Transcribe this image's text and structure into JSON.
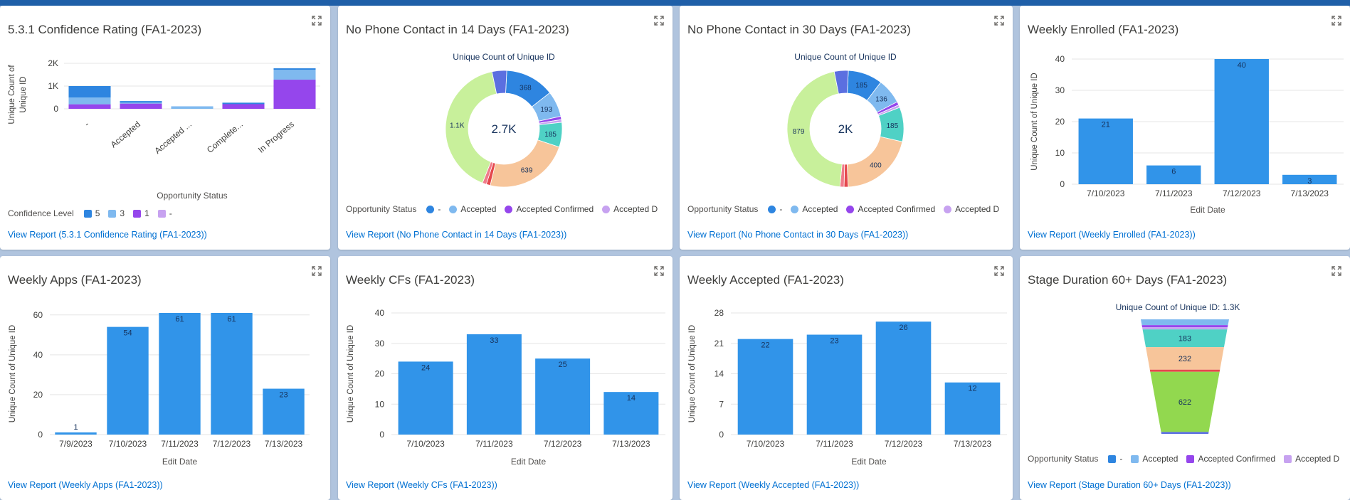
{
  "colors": {
    "status_dash": "#2e85e0",
    "accepted": "#7fb9ef",
    "accepted_confirmed": "#9546ec",
    "accepted_d": "#c7a2f0",
    "teal": "#4fd1c5",
    "peach": "#f7c59a",
    "red": "#e5484d",
    "green_light": "#c8f09b",
    "green": "#92d84f",
    "conf5": "#2e85e0",
    "conf3": "#7fb9ef",
    "conf1": "#9546ec",
    "conf_dash": "#c7a2f0",
    "bar": "#3194e9",
    "link": "#0070d2"
  },
  "cards": {
    "confidence": {
      "title": "5.3.1 Confidence Rating (FA1-2023)",
      "link": "View Report (5.3.1 Confidence Rating (FA1-2023))",
      "legend_title": "Confidence Level",
      "legend": [
        "5",
        "3",
        "1",
        "-"
      ]
    },
    "phone14": {
      "title": "No Phone Contact in 14 Days (FA1-2023)",
      "link": "View Report (No Phone Contact in 14 Days (FA1-2023))",
      "legend_title": "Opportunity Status",
      "legend": [
        "-",
        "Accepted",
        "Accepted Confirmed",
        "Accepted D"
      ]
    },
    "phone30": {
      "title": "No Phone Contact in 30 Days (FA1-2023)",
      "link": "View Report (No Phone Contact in 30 Days (FA1-2023))",
      "legend_title": "Opportunity Status",
      "legend": [
        "-",
        "Accepted",
        "Accepted Confirmed",
        "Accepted D"
      ]
    },
    "enrolled": {
      "title": "Weekly Enrolled (FA1-2023)",
      "link": "View Report (Weekly Enrolled (FA1-2023))"
    },
    "apps": {
      "title": "Weekly Apps (FA1-2023)",
      "link": "View Report (Weekly Apps (FA1-2023))"
    },
    "cfs": {
      "title": "Weekly CFs (FA1-2023)",
      "link": "View Report (Weekly CFs (FA1-2023))"
    },
    "accepted": {
      "title": "Weekly Accepted (FA1-2023)",
      "link": "View Report (Weekly Accepted (FA1-2023))"
    },
    "stage": {
      "title": "Stage Duration 60+ Days (FA1-2023)",
      "link": "View Report (Stage Duration 60+ Days (FA1-2023))",
      "legend_title": "Opportunity Status",
      "legend": [
        "-",
        "Accepted",
        "Accepted Confirmed",
        "Accepted D"
      ]
    }
  },
  "chart_data": [
    {
      "id": "confidence",
      "type": "bar",
      "stacked": true,
      "title": "",
      "xlabel": "Opportunity Status",
      "ylabel": "Unique Count of Unique ID",
      "categories": [
        "-",
        "Accepted",
        "Accepted ...",
        "Complete...",
        "In Progress"
      ],
      "yticks": [
        "0",
        "1K",
        "2K"
      ],
      "ylim": [
        0,
        2000
      ],
      "series": [
        {
          "name": "1",
          "values": [
            200,
            230,
            0,
            220,
            1280
          ]
        },
        {
          "name": "3",
          "values": [
            300,
            70,
            110,
            0,
            440
          ]
        },
        {
          "name": "5",
          "values": [
            500,
            40,
            0,
            50,
            60
          ]
        }
      ]
    },
    {
      "id": "phone14",
      "type": "pie",
      "title": "Unique Count of Unique ID",
      "center_label": "2.7K",
      "slices": [
        {
          "label": "368",
          "value": 368
        },
        {
          "label": "193",
          "value": 193
        },
        {
          "label": "",
          "value": 25
        },
        {
          "label": "",
          "value": 20
        },
        {
          "label": "185",
          "value": 185
        },
        {
          "label": "639",
          "value": 639
        },
        {
          "label": "",
          "value": 30
        },
        {
          "label": "",
          "value": 30
        },
        {
          "label": "1.1K",
          "value": 1100
        },
        {
          "label": "",
          "value": 110
        }
      ]
    },
    {
      "id": "phone30",
      "type": "pie",
      "title": "Unique Count of Unique ID",
      "center_label": "2K",
      "slices": [
        {
          "label": "185",
          "value": 185
        },
        {
          "label": "136",
          "value": 136
        },
        {
          "label": "",
          "value": 18
        },
        {
          "label": "",
          "value": 14
        },
        {
          "label": "185",
          "value": 185
        },
        {
          "label": "400",
          "value": 400
        },
        {
          "label": "",
          "value": 22
        },
        {
          "label": "",
          "value": 22
        },
        {
          "label": "879",
          "value": 879
        },
        {
          "label": "",
          "value": 75
        }
      ]
    },
    {
      "id": "enrolled",
      "type": "bar",
      "xlabel": "Edit Date",
      "ylabel": "Unique Count of Unique ID",
      "categories": [
        "7/10/2023",
        "7/11/2023",
        "7/12/2023",
        "7/13/2023"
      ],
      "values": [
        21,
        6,
        40,
        3
      ],
      "yticks": [
        0,
        10,
        20,
        30,
        40
      ],
      "ylim": [
        0,
        40
      ]
    },
    {
      "id": "apps",
      "type": "bar",
      "xlabel": "Edit Date",
      "ylabel": "Unique Count of Unique ID",
      "categories": [
        "7/9/2023",
        "7/10/2023",
        "7/11/2023",
        "7/12/2023",
        "7/13/2023"
      ],
      "values": [
        1,
        54,
        61,
        61,
        23
      ],
      "yticks": [
        0,
        20,
        40,
        60
      ],
      "ylim": [
        0,
        61
      ]
    },
    {
      "id": "cfs",
      "type": "bar",
      "xlabel": "Edit Date",
      "ylabel": "Unique Count of Unique ID",
      "categories": [
        "7/10/2023",
        "7/11/2023",
        "7/12/2023",
        "7/13/2023"
      ],
      "values": [
        24,
        33,
        25,
        14
      ],
      "yticks": [
        0,
        10,
        20,
        30,
        40
      ],
      "ylim": [
        0,
        40
      ]
    },
    {
      "id": "accepted",
      "type": "bar",
      "xlabel": "Edit Date",
      "ylabel": "Unique Count of Unique ID",
      "categories": [
        "7/10/2023",
        "7/11/2023",
        "7/12/2023",
        "7/13/2023"
      ],
      "values": [
        22,
        23,
        26,
        12
      ],
      "yticks": [
        0,
        7,
        14,
        21,
        28
      ],
      "ylim": [
        0,
        28
      ]
    },
    {
      "id": "stage",
      "type": "funnel",
      "title": "Unique Count of Unique ID: 1.3K",
      "segments": [
        {
          "label": "",
          "value": 60
        },
        {
          "label": "",
          "value": 15
        },
        {
          "label": "",
          "value": 10
        },
        {
          "label": "183",
          "value": 183
        },
        {
          "label": "232",
          "value": 232
        },
        {
          "label": "",
          "value": 15
        },
        {
          "label": "622",
          "value": 622
        },
        {
          "label": "",
          "value": 45
        }
      ]
    }
  ]
}
